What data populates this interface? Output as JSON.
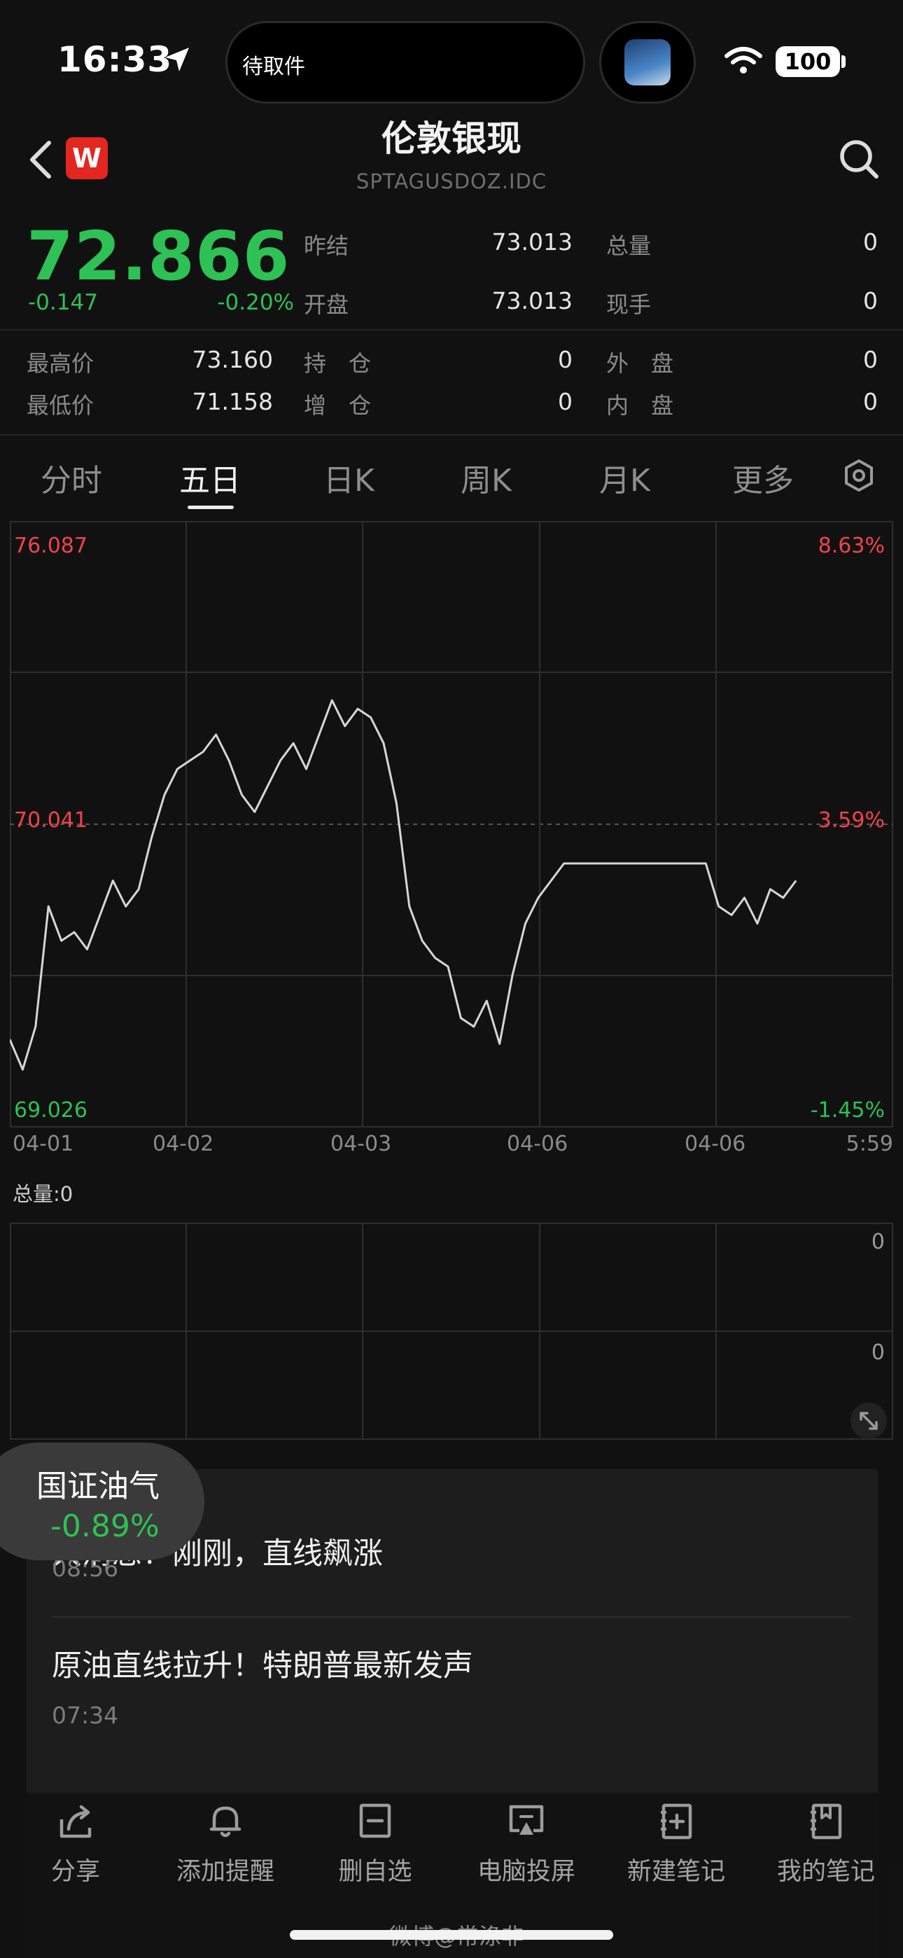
{
  "status_bar": {
    "time": "16:33",
    "island_text": "待取件",
    "battery": "100",
    "icons": [
      "location-arrow-icon",
      "wifi-icon",
      "battery-icon"
    ]
  },
  "header": {
    "title": "伦敦银现",
    "subtitle": "SPTAGUSDOZ.IDC",
    "logo_letter": "W",
    "icons": [
      "back-chevron-icon",
      "search-icon"
    ]
  },
  "quote": {
    "price": "72.866",
    "change": "-0.147",
    "change_pct": "-0.20%",
    "stats": [
      {
        "label": "昨结",
        "value": "73.013"
      },
      {
        "label": "开盘",
        "value": "73.013"
      },
      {
        "label": "总量",
        "value": "0"
      },
      {
        "label": "现手",
        "value": "0"
      },
      {
        "label": "最高价",
        "value": "73.160"
      },
      {
        "label": "最低价",
        "value": "71.158"
      },
      {
        "label": "持　仓",
        "value": "0"
      },
      {
        "label": "增　仓",
        "value": "0"
      },
      {
        "label": "外　盘",
        "value": "0"
      },
      {
        "label": "内　盘",
        "value": "0"
      }
    ]
  },
  "tabs": [
    {
      "label": "分时",
      "active": false
    },
    {
      "label": "五日",
      "active": true
    },
    {
      "label": "日K",
      "active": false
    },
    {
      "label": "周K",
      "active": false
    },
    {
      "label": "月K",
      "active": false
    },
    {
      "label": "更多",
      "active": false
    }
  ],
  "chart_data": {
    "type": "line",
    "y_top": "76.087",
    "y_mid": "70.041",
    "y_bottom": "69.026",
    "pct_top": "8.63%",
    "pct_mid": "3.59%",
    "pct_bottom": "-1.45%",
    "ylim": [
      69.026,
      76.087
    ],
    "x_ticks": [
      "04-01",
      "04-02",
      "04-03",
      "04-06",
      "04-06",
      "5:59"
    ],
    "series": [
      {
        "values": [
          70.05,
          69.7,
          70.2,
          71.6,
          71.2,
          71.3,
          71.1,
          71.5,
          71.9,
          71.6,
          71.8,
          72.4,
          72.9,
          73.2,
          73.3,
          73.4,
          73.6,
          73.3,
          72.9,
          72.7,
          73.0,
          73.3,
          73.5,
          73.2,
          73.6,
          74.0,
          73.7,
          73.9,
          73.8,
          73.5,
          72.8,
          71.6,
          71.2,
          71.0,
          70.9,
          70.3,
          70.2,
          70.5,
          70.0,
          70.8,
          71.4,
          71.7,
          71.9,
          72.1,
          72.1,
          72.1,
          72.1,
          72.1,
          72.1,
          72.1,
          72.1,
          72.1,
          72.1,
          72.1,
          72.1,
          71.6,
          71.5,
          71.7,
          71.4,
          71.8,
          71.7,
          71.9
        ]
      }
    ]
  },
  "volume": {
    "label": "总量:0",
    "ticks": [
      "0",
      "0"
    ]
  },
  "floating_badge": {
    "name": "国证油气",
    "change_pct": "-0.89%"
  },
  "news": [
    {
      "title": "大消息！刚刚，直线飙涨",
      "time": "08:56"
    },
    {
      "title": "原油直线拉升！特朗普最新发声",
      "time": "07:34"
    }
  ],
  "toolbar": [
    {
      "label": "分享",
      "icon": "share-icon"
    },
    {
      "label": "添加提醒",
      "icon": "bell-icon"
    },
    {
      "label": "删自选",
      "icon": "remove-watchlist-icon"
    },
    {
      "label": "电脑投屏",
      "icon": "cast-screen-icon"
    },
    {
      "label": "新建笔记",
      "icon": "new-note-icon"
    },
    {
      "label": "我的笔记",
      "icon": "my-notes-icon"
    }
  ],
  "watermark": "微博@常涤非",
  "colors": {
    "up": "#f0434b",
    "down": "#2ec155",
    "line": "#d6d6d6",
    "grid": "#2e2e2e"
  }
}
